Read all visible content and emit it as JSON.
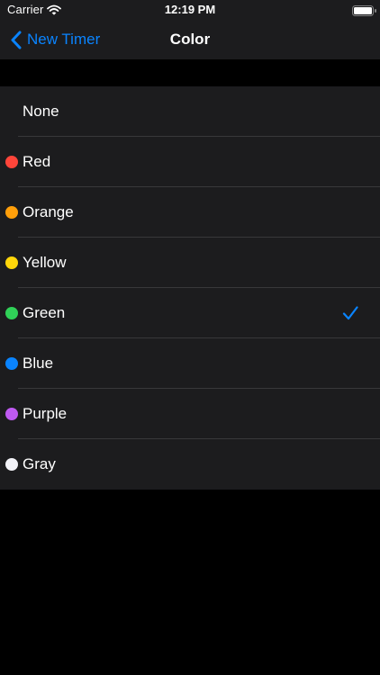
{
  "status_bar": {
    "carrier": "Carrier",
    "time": "12:19 PM"
  },
  "nav": {
    "back_label": "New Timer",
    "title": "Color"
  },
  "accent_color": "#0a84ff",
  "selected": "Green",
  "colors": [
    {
      "name": "None",
      "swatch": null
    },
    {
      "name": "Red",
      "swatch": "#ff453a"
    },
    {
      "name": "Orange",
      "swatch": "#ff9f0a"
    },
    {
      "name": "Yellow",
      "swatch": "#ffd60a"
    },
    {
      "name": "Green",
      "swatch": "#30d158"
    },
    {
      "name": "Blue",
      "swatch": "#0a84ff"
    },
    {
      "name": "Purple",
      "swatch": "#bf5af2"
    },
    {
      "name": "Gray",
      "swatch": "#f2f2f7"
    }
  ]
}
